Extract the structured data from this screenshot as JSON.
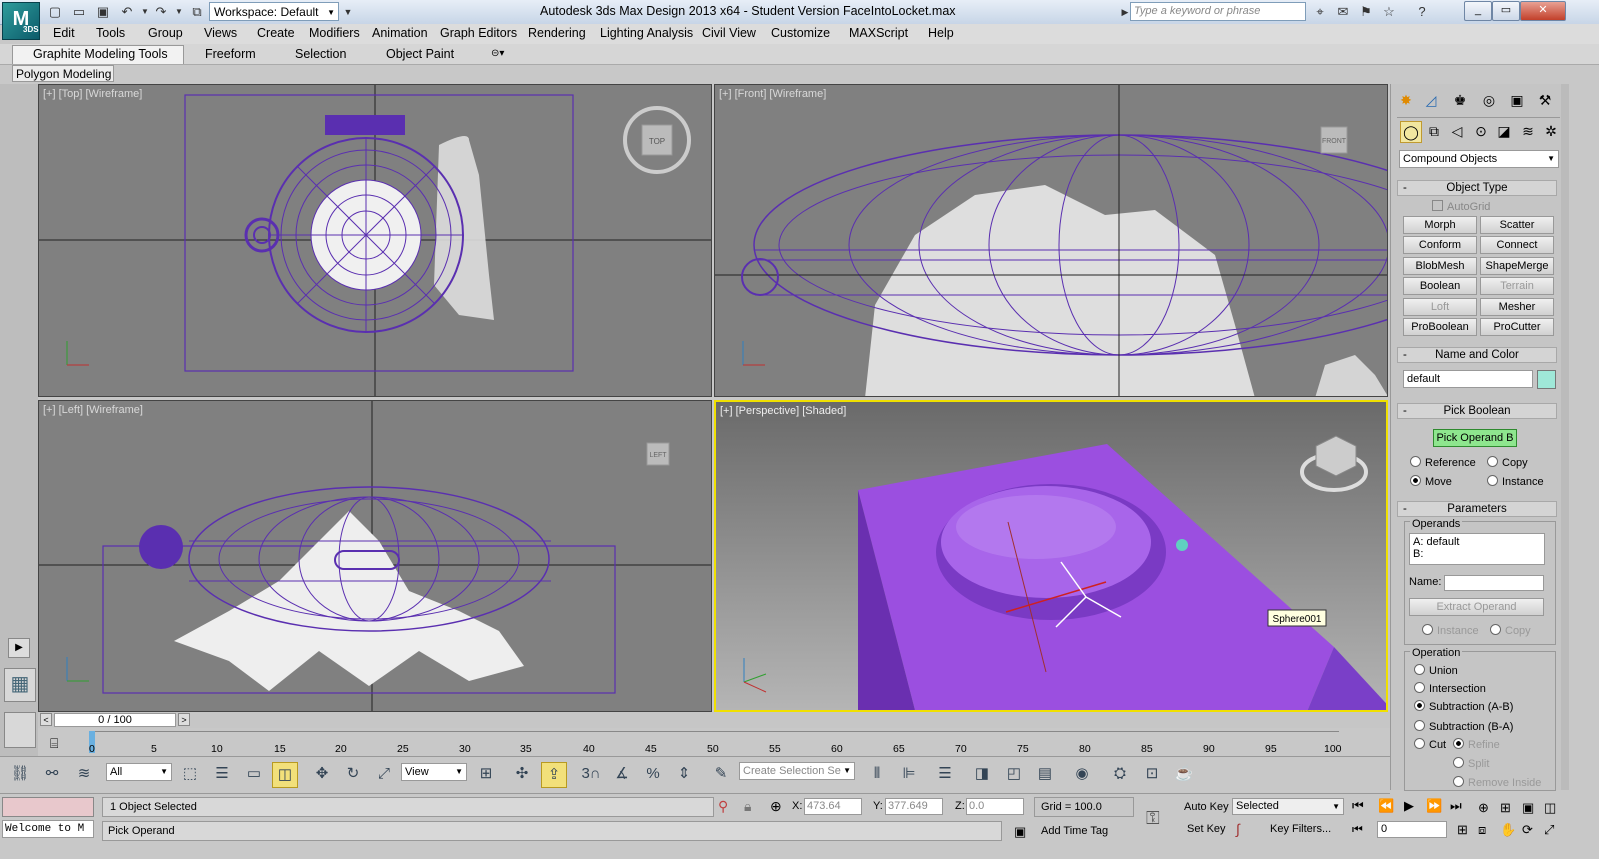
{
  "titlebar": {
    "logo": "M",
    "logo_sub": "3DS",
    "workspace": "Workspace: Default",
    "title": "Autodesk 3ds Max Design 2013 x64  -  Student Version     FaceIntoLocket.max",
    "search_placeholder": "Type a keyword or phrase"
  },
  "menu": [
    "Edit",
    "Tools",
    "Group",
    "Views",
    "Create",
    "Modifiers",
    "Animation",
    "Graph Editors",
    "Rendering",
    "Lighting Analysis",
    "Civil View",
    "Customize",
    "MAXScript",
    "Help"
  ],
  "ribbon": {
    "tabs": [
      "Graphite Modeling Tools",
      "Freeform",
      "Selection",
      "Object Paint"
    ],
    "sub": "Polygon Modeling"
  },
  "viewports": {
    "top": "[+] [Top] [Wireframe]",
    "front": "[+] [Front] [Wireframe]",
    "left": "[+] [Left] [Wireframe]",
    "persp": "[+] [Perspective] [Shaded]",
    "nav_top": "TOP",
    "nav_front": "FRONT",
    "nav_left": "LEFT",
    "sphere_tag": "Sphere001"
  },
  "colors": {
    "wire": "#5a2fb0",
    "purple_solid": "#9b4fe0",
    "active_border": "#f0e000",
    "viewport_bg": "#808080"
  },
  "panel": {
    "category": "Compound Objects",
    "object_type": "Object Type",
    "autogrid": "AutoGrid",
    "buttons": [
      {
        "label": "Morph",
        "enabled": true
      },
      {
        "label": "Scatter",
        "enabled": true
      },
      {
        "label": "Conform",
        "enabled": true
      },
      {
        "label": "Connect",
        "enabled": true
      },
      {
        "label": "BlobMesh",
        "enabled": true
      },
      {
        "label": "ShapeMerge",
        "enabled": true
      },
      {
        "label": "Boolean",
        "enabled": true
      },
      {
        "label": "Terrain",
        "enabled": false
      },
      {
        "label": "Loft",
        "enabled": false
      },
      {
        "label": "Mesher",
        "enabled": true
      },
      {
        "label": "ProBoolean",
        "enabled": true
      },
      {
        "label": "ProCutter",
        "enabled": true
      }
    ],
    "name_color": "Name and Color",
    "name_value": "default",
    "pick_boolean": "Pick Boolean",
    "pick_operand": "Pick Operand B",
    "reference": "Reference",
    "copy": "Copy",
    "move": "Move",
    "instance": "Instance",
    "parameters": "Parameters",
    "operands": "Operands",
    "operand_a": "A: default",
    "operand_b": "B:",
    "name_label": "Name:",
    "extract": "Extract Operand",
    "instance2": "Instance",
    "copy2": "Copy",
    "operation": "Operation",
    "union": "Union",
    "intersection": "Intersection",
    "sub_ab": "Subtraction (A-B)",
    "sub_ba": "Subtraction (B-A)",
    "cut": "Cut",
    "refine": "Refine",
    "split": "Split",
    "remove_inside": "Remove Inside"
  },
  "timeline": {
    "frame": "0 / 100",
    "ticks": [
      "0",
      "5",
      "10",
      "15",
      "20",
      "25",
      "30",
      "35",
      "40",
      "45",
      "50",
      "55",
      "60",
      "65",
      "70",
      "75",
      "80",
      "85",
      "90",
      "95",
      "100"
    ]
  },
  "toolbar": {
    "filter": "All",
    "refcoord": "View",
    "selset_placeholder": "Create Selection Se"
  },
  "status": {
    "selected": "1 Object Selected",
    "prompt": "Pick Operand",
    "welcome": "Welcome to M",
    "x_label": "X:",
    "x_value": "473.64",
    "y_label": "Y:",
    "y_value": "377.649",
    "z_label": "Z:",
    "z_value": "0.0",
    "grid": "Grid = 100.0",
    "add_time_tag": "Add Time Tag",
    "auto_key": "Auto Key",
    "set_key": "Set Key",
    "key_mode": "Selected",
    "key_filters": "Key Filters...",
    "frame_value": "0"
  }
}
